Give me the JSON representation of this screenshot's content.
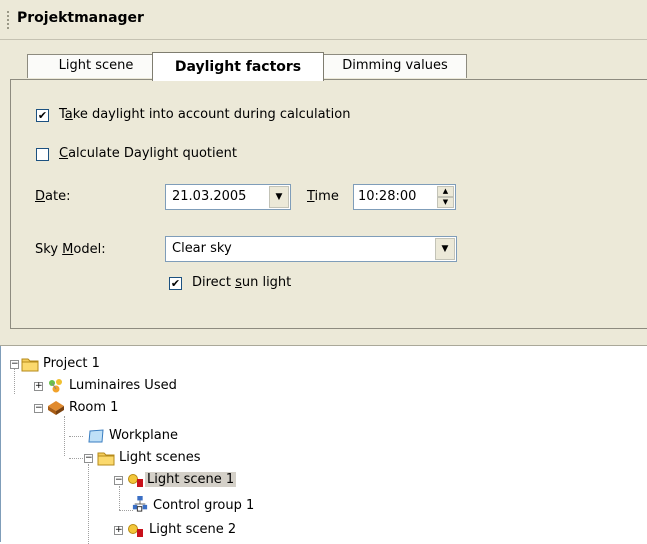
{
  "window": {
    "title": "Projektmanager"
  },
  "tabs": [
    {
      "label": "Light scene"
    },
    {
      "label": "Daylight factors"
    },
    {
      "label": "Dimming values"
    }
  ],
  "daylight": {
    "take_into_account": {
      "pre": "T",
      "mnemonic": "a",
      "post": "ke daylight into account during calculation",
      "checked": "✔"
    },
    "quotient": {
      "mnemonic": "C",
      "post": "alculate Daylight quotient",
      "checked": ""
    },
    "date_label": {
      "mnemonic": "D",
      "post": "ate:"
    },
    "date_value": "21.03.2005",
    "time_label": {
      "mnemonic": "T",
      "post": "ime"
    },
    "time_value": "10:28:00",
    "sky_label": {
      "pre": "Sky ",
      "mnemonic": "M",
      "post": "odel:"
    },
    "sky_value": "Clear sky",
    "direct_sun": {
      "pre": "Direct ",
      "mnemonic": "s",
      "post": "un light",
      "checked": "✔"
    }
  },
  "tree": {
    "items": [
      {
        "label": "Project 1",
        "expander": "−"
      },
      {
        "label": "Luminaires Used",
        "expander": "+"
      },
      {
        "label": "Room 1",
        "expander": "−"
      },
      {
        "label": "Workplane"
      },
      {
        "label": "Light scenes",
        "expander": "−"
      },
      {
        "label": "Light scene 1",
        "expander": "−"
      },
      {
        "label": "Control group 1"
      },
      {
        "label": "Light scene 2",
        "expander": "+"
      }
    ]
  },
  "icons": {
    "folder": "folder-icon",
    "luminaires": "luminaires-icon",
    "room": "room-icon",
    "workplane": "workplane-icon",
    "light_scene": "light-scene-icon",
    "control_group": "control-group-icon"
  },
  "colors": {
    "panel": "#ece9d8",
    "field_border": "#7f9db9",
    "selection": "#d4d0c8"
  }
}
